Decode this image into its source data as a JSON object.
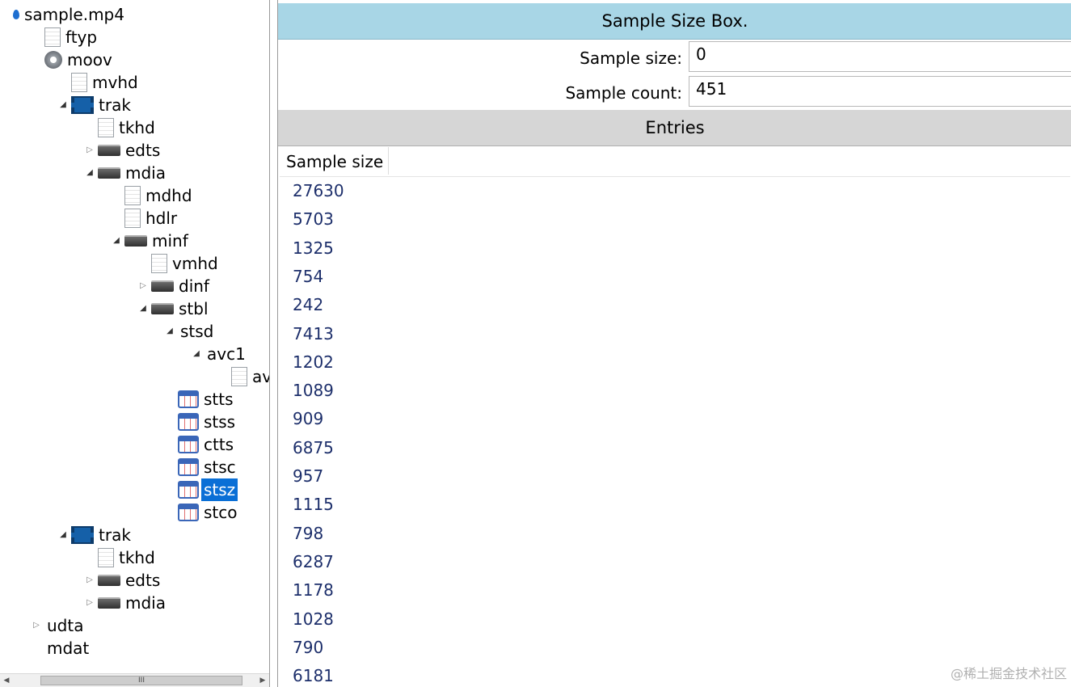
{
  "tree": {
    "items": [
      {
        "label": "sample.mp4",
        "icon": "water-drop-icon",
        "level": 0,
        "expander": "none"
      },
      {
        "label": "ftyp",
        "icon": "document-icon",
        "level": 1,
        "expander": "none"
      },
      {
        "label": "moov",
        "icon": "gear-icon",
        "level": 1,
        "expander": "none"
      },
      {
        "label": "mvhd",
        "icon": "document-icon",
        "level": 2,
        "expander": "none"
      },
      {
        "label": "trak",
        "icon": "film-icon",
        "level": 2,
        "expander": "expanded"
      },
      {
        "label": "tkhd",
        "icon": "document-icon",
        "level": 3,
        "expander": "none"
      },
      {
        "label": "edts",
        "icon": "box-icon",
        "level": 3,
        "expander": "collapsed"
      },
      {
        "label": "mdia",
        "icon": "box-icon",
        "level": 3,
        "expander": "expanded"
      },
      {
        "label": "mdhd",
        "icon": "document-icon",
        "level": 4,
        "expander": "none"
      },
      {
        "label": "hdlr",
        "icon": "document-icon",
        "level": 4,
        "expander": "none"
      },
      {
        "label": "minf",
        "icon": "box-icon",
        "level": 4,
        "expander": "expanded"
      },
      {
        "label": "vmhd",
        "icon": "document-icon",
        "level": 5,
        "expander": "none"
      },
      {
        "label": "dinf",
        "icon": "box-icon",
        "level": 5,
        "expander": "collapsed"
      },
      {
        "label": "stbl",
        "icon": "box-icon",
        "level": 5,
        "expander": "expanded"
      },
      {
        "label": "stsd",
        "icon": "none",
        "level": 6,
        "expander": "expanded"
      },
      {
        "label": "avc1",
        "icon": "none",
        "level": 7,
        "expander": "expanded"
      },
      {
        "label": "avcC",
        "icon": "document-icon",
        "level": 8,
        "expander": "none"
      },
      {
        "label": "stts",
        "icon": "table-icon",
        "level": 6,
        "expander": "none"
      },
      {
        "label": "stss",
        "icon": "table-icon",
        "level": 6,
        "expander": "none"
      },
      {
        "label": "ctts",
        "icon": "table-icon",
        "level": 6,
        "expander": "none"
      },
      {
        "label": "stsc",
        "icon": "table-icon",
        "level": 6,
        "expander": "none"
      },
      {
        "label": "stsz",
        "icon": "table-icon",
        "level": 6,
        "expander": "none",
        "selected": true
      },
      {
        "label": "stco",
        "icon": "table-icon",
        "level": 6,
        "expander": "none"
      },
      {
        "label": "trak",
        "icon": "film-icon",
        "level": 2,
        "expander": "expanded"
      },
      {
        "label": "tkhd",
        "icon": "document-icon",
        "level": 3,
        "expander": "none"
      },
      {
        "label": "edts",
        "icon": "box-icon",
        "level": 3,
        "expander": "collapsed"
      },
      {
        "label": "mdia",
        "icon": "box-icon",
        "level": 3,
        "expander": "collapsed"
      },
      {
        "label": "udta",
        "icon": "none",
        "level": 1,
        "expander": "collapsed"
      },
      {
        "label": "mdat",
        "icon": "none",
        "level": 1,
        "expander": "none"
      }
    ],
    "scroll_thumb_label": "III"
  },
  "detail": {
    "title": "Sample Size Box.",
    "sample_size_label": "Sample size:",
    "sample_size_value": "0",
    "sample_count_label": "Sample count:",
    "sample_count_value": "451",
    "entries_title": "Entries",
    "column_header": "Sample size",
    "entries": [
      "27630",
      "5703",
      "1325",
      "754",
      "242",
      "7413",
      "1202",
      "1089",
      "909",
      "6875",
      "957",
      "1115",
      "798",
      "6287",
      "1178",
      "1028",
      "790",
      "6181"
    ]
  },
  "watermark": "@稀土掘金技术社区",
  "colors": {
    "header_blue": "#a8d6e6",
    "entries_gray": "#d6d6d6",
    "selection_blue": "#0a6fd6",
    "cell_text": "#1d2f6b"
  }
}
